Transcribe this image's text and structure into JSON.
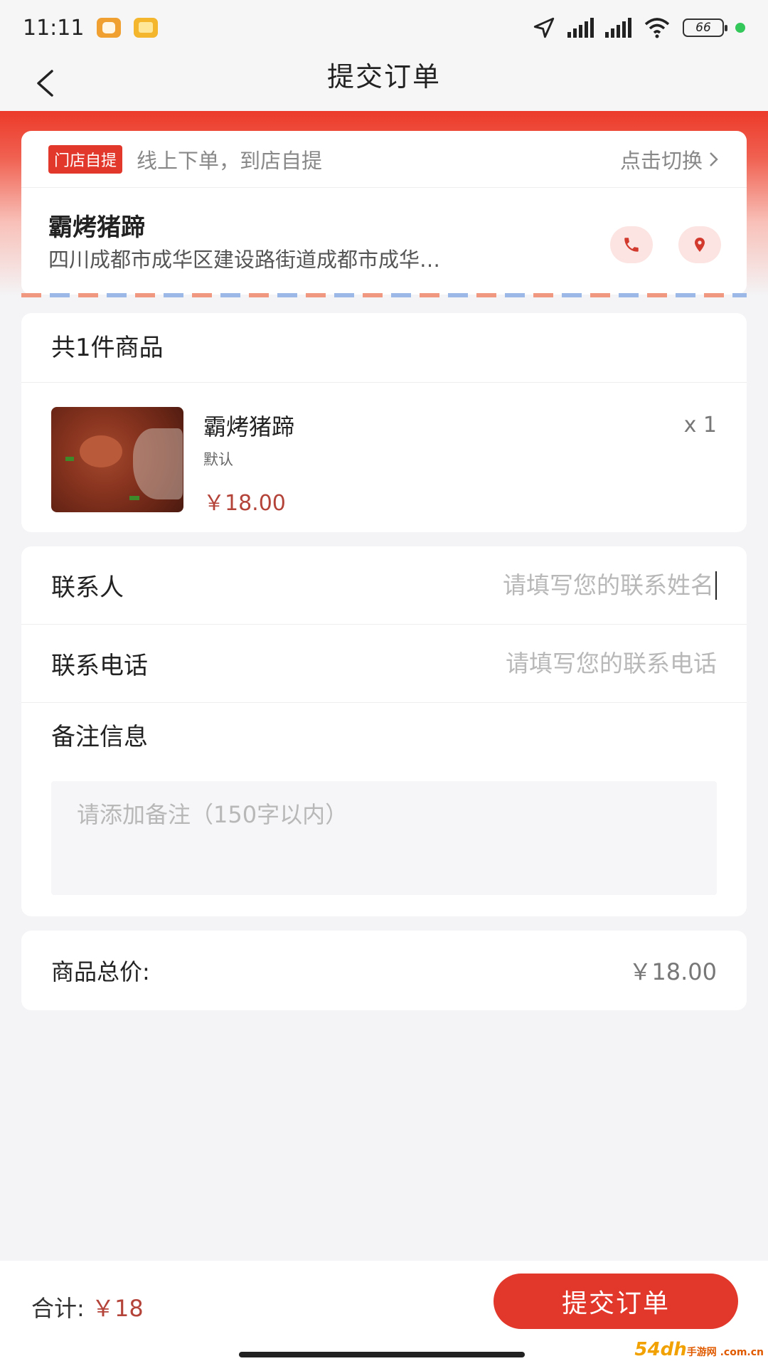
{
  "status_bar": {
    "time": "11:11",
    "battery": "66",
    "icons": [
      "app-icon",
      "gallery-icon",
      "location-arrow-icon",
      "signal-icon",
      "signal-icon",
      "wifi-icon",
      "battery-icon"
    ]
  },
  "nav": {
    "title": "提交订单",
    "back_icon": "chevron-left-icon"
  },
  "store": {
    "tag": "门店自提",
    "hint": "线上下单，到店自提",
    "switch_label": "点击切换",
    "name": "霸烤猪蹄",
    "address": "四川成都市成华区建设路街道成都市成华…",
    "phone_icon": "phone-icon",
    "location_icon": "location-pin-icon"
  },
  "goods": {
    "header": "共1件商品",
    "items": [
      {
        "name": "霸烤猪蹄",
        "spec": "默认",
        "price": "￥18.00",
        "qty": "x 1"
      }
    ]
  },
  "form": {
    "contact_label": "联系人",
    "contact_placeholder": "请填写您的联系姓名",
    "phone_label": "联系电话",
    "phone_placeholder": "请填写您的联系电话",
    "remark_label": "备注信息",
    "remark_placeholder": "请添加备注（150字以内）"
  },
  "summary": {
    "total_label": "商品总价:",
    "total_value": "￥18.00"
  },
  "bottom": {
    "sum_label": "合计:",
    "sum_value": "￥18",
    "submit_label": "提交订单"
  },
  "watermark": {
    "brand": "54dh",
    "site": "手游网 .com.cn"
  },
  "colors": {
    "accent": "#e2372b",
    "price": "#b4433a",
    "background": "#f4f4f6"
  }
}
